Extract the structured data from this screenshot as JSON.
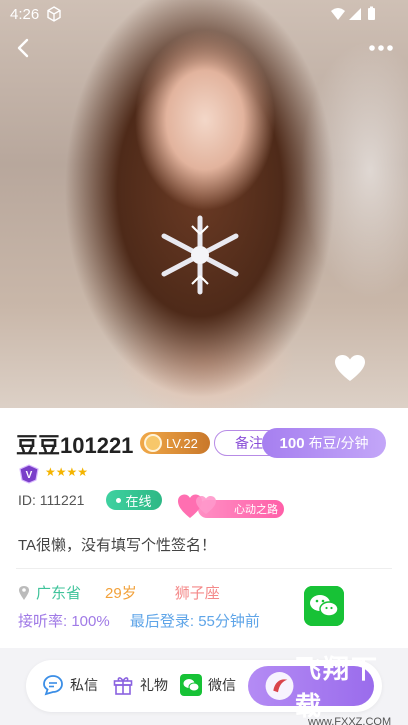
{
  "status_bar": {
    "time": "4:26"
  },
  "profile": {
    "name": "豆豆101221",
    "level": "LV.22",
    "note_label": "备注",
    "price": {
      "amount": "100",
      "unit": "布豆/分钟"
    },
    "stars": "★★★★",
    "vip_badge_letter": "V",
    "user_id": "ID: 111221",
    "online_label": "在线",
    "heartbeat_label": "心动之路",
    "signature": "TA很懒，没有填写个性签名！",
    "province": "广东省",
    "age": "29岁",
    "zodiac": "狮子座",
    "answer_rate": "接听率: 100%",
    "last_login": "最后登录: 55分钟前"
  },
  "actions": {
    "message_label": "私信",
    "gift_label": "礼物",
    "wechat_label": "微信"
  },
  "watermark": {
    "text": "飞翔下载",
    "sub": "www.FXXZ.COM"
  },
  "colors": {
    "accent_purple": "#a67ff0",
    "online_green": "#2db885",
    "wechat_green": "#17c236",
    "level_orange": "#f0a848"
  },
  "icons": [
    "cube-icon",
    "wifi-icon",
    "signal-icon",
    "battery-icon",
    "back-arrow-icon",
    "more-dots-icon",
    "heart-icon",
    "location-pin-icon",
    "wechat-icon",
    "message-icon",
    "gift-icon"
  ]
}
